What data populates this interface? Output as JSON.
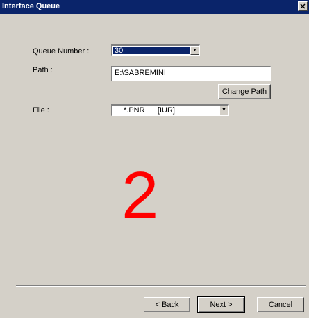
{
  "window": {
    "title": "Interface Queue"
  },
  "form": {
    "queue_number_label": "Queue Number :",
    "queue_number_value": "30",
    "path_label": "Path :",
    "path_value": "E:\\SABREMINI",
    "change_path_label": "Change Path",
    "file_label": "File :",
    "file_value": "*.PNR      [IUR]"
  },
  "overlay": {
    "step_number": "2"
  },
  "footer": {
    "back_label": "< Back",
    "next_label": "Next >",
    "cancel_label": "Cancel"
  },
  "colors": {
    "titlebar": "#0a246a",
    "selection": "#0a246a",
    "overlay_number": "#ff0000",
    "face": "#d4d0c8"
  },
  "icons": {
    "close": "close-icon",
    "dropdown": "chevron-down-icon"
  }
}
